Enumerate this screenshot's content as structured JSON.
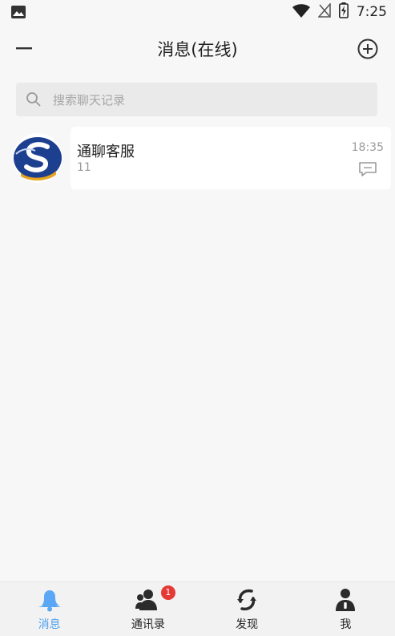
{
  "status_bar": {
    "time": "7:25",
    "icons": [
      "image-icon",
      "wifi-icon",
      "no-signal-icon",
      "battery-icon"
    ]
  },
  "header": {
    "title": "消息(在线)",
    "left_icon": "menu-icon",
    "right_icon": "add-circle-icon"
  },
  "search": {
    "placeholder": "搜索聊天记录",
    "icon": "search-icon"
  },
  "conversations": [
    {
      "name": "通聊客服",
      "preview": "11",
      "time": "18:35",
      "avatar_icon": "customer-service-logo",
      "status_icon": "message-icon"
    }
  ],
  "tabbar": {
    "tabs": [
      {
        "label": "消息",
        "icon": "bell-icon",
        "active": true
      },
      {
        "label": "通讯录",
        "icon": "contacts-icon",
        "badge": "1"
      },
      {
        "label": "发现",
        "icon": "discover-icon"
      },
      {
        "label": "我",
        "icon": "user-icon"
      }
    ],
    "accent_color": "#4a9ff0",
    "badge_color": "#e53935"
  }
}
